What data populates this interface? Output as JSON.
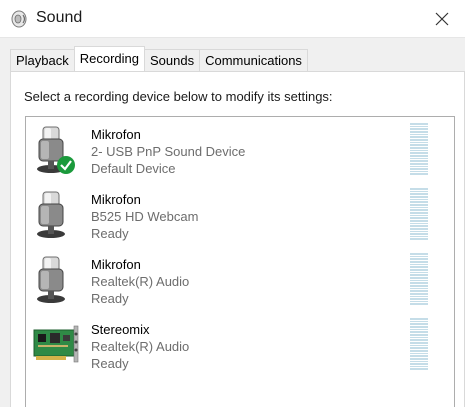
{
  "window": {
    "title": "Sound",
    "close_icon": "close-icon"
  },
  "tabs": [
    {
      "label": "Playback",
      "active": false
    },
    {
      "label": "Recording",
      "active": true
    },
    {
      "label": "Sounds",
      "active": false
    },
    {
      "label": "Communications",
      "active": false
    }
  ],
  "recording": {
    "instruction": "Select a recording device below to modify its settings:",
    "devices": [
      {
        "name": "Mikrofon",
        "description": "2- USB PnP Sound Device",
        "status": "Default Device",
        "icon": "microphone-icon",
        "is_default": true
      },
      {
        "name": "Mikrofon",
        "description": "B525 HD Webcam",
        "status": "Ready",
        "icon": "microphone-icon",
        "is_default": false
      },
      {
        "name": "Mikrofon",
        "description": "Realtek(R) Audio",
        "status": "Ready",
        "icon": "microphone-icon",
        "is_default": false
      },
      {
        "name": "Stereomix",
        "description": "Realtek(R) Audio",
        "status": "Ready",
        "icon": "sound-card-icon",
        "is_default": false
      }
    ]
  },
  "colors": {
    "default_check": "#1b9a3c",
    "meter": "#c5dde8",
    "secondary_text": "#6d6d6d"
  }
}
